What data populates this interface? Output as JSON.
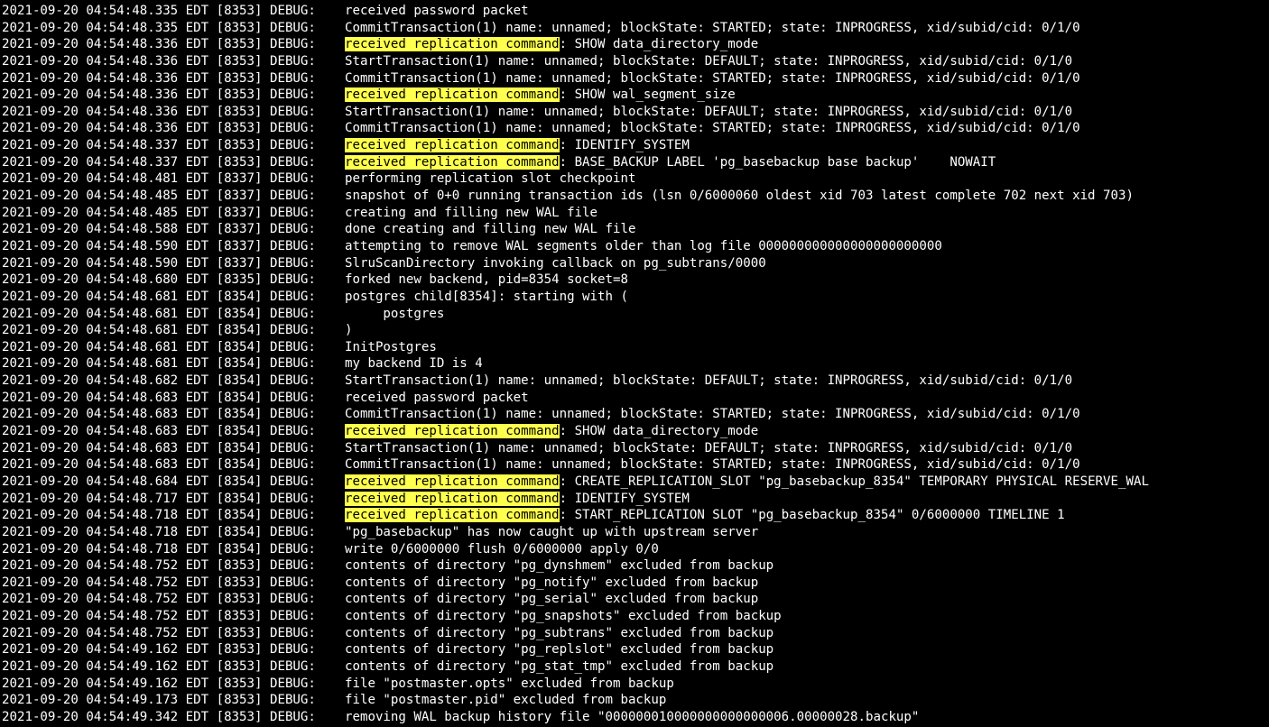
{
  "terminal": {
    "highlight_color": "#ffff4d",
    "lines": [
      {
        "p": "2021-09-20 04:54:48.335 EDT [8353] DEBUG:",
        "h": "",
        "m": "received password packet"
      },
      {
        "p": "2021-09-20 04:54:48.335 EDT [8353] DEBUG:",
        "h": "",
        "m": "CommitTransaction(1) name: unnamed; blockState: STARTED; state: INPROGRESS, xid/subid/cid: 0/1/0"
      },
      {
        "p": "2021-09-20 04:54:48.336 EDT [8353] DEBUG:",
        "h": "received replication command",
        "m": ": SHOW data_directory_mode"
      },
      {
        "p": "2021-09-20 04:54:48.336 EDT [8353] DEBUG:",
        "h": "",
        "m": "StartTransaction(1) name: unnamed; blockState: DEFAULT; state: INPROGRESS, xid/subid/cid: 0/1/0"
      },
      {
        "p": "2021-09-20 04:54:48.336 EDT [8353] DEBUG:",
        "h": "",
        "m": "CommitTransaction(1) name: unnamed; blockState: STARTED; state: INPROGRESS, xid/subid/cid: 0/1/0"
      },
      {
        "p": "2021-09-20 04:54:48.336 EDT [8353] DEBUG:",
        "h": "received replication command",
        "m": ": SHOW wal_segment_size"
      },
      {
        "p": "2021-09-20 04:54:48.336 EDT [8353] DEBUG:",
        "h": "",
        "m": "StartTransaction(1) name: unnamed; blockState: DEFAULT; state: INPROGRESS, xid/subid/cid: 0/1/0"
      },
      {
        "p": "2021-09-20 04:54:48.336 EDT [8353] DEBUG:",
        "h": "",
        "m": "CommitTransaction(1) name: unnamed; blockState: STARTED; state: INPROGRESS, xid/subid/cid: 0/1/0"
      },
      {
        "p": "2021-09-20 04:54:48.337 EDT [8353] DEBUG:",
        "h": "received replication command",
        "m": ": IDENTIFY_SYSTEM"
      },
      {
        "p": "2021-09-20 04:54:48.337 EDT [8353] DEBUG:",
        "h": "received replication command",
        "m": ": BASE_BACKUP LABEL 'pg_basebackup base backup'    NOWAIT"
      },
      {
        "p": "2021-09-20 04:54:48.481 EDT [8337] DEBUG:",
        "h": "",
        "m": "performing replication slot checkpoint"
      },
      {
        "p": "2021-09-20 04:54:48.485 EDT [8337] DEBUG:",
        "h": "",
        "m": "snapshot of 0+0 running transaction ids (lsn 0/6000060 oldest xid 703 latest complete 702 next xid 703)"
      },
      {
        "p": "2021-09-20 04:54:48.485 EDT [8337] DEBUG:",
        "h": "",
        "m": "creating and filling new WAL file"
      },
      {
        "p": "2021-09-20 04:54:48.588 EDT [8337] DEBUG:",
        "h": "",
        "m": "done creating and filling new WAL file"
      },
      {
        "p": "2021-09-20 04:54:48.590 EDT [8337] DEBUG:",
        "h": "",
        "m": "attempting to remove WAL segments older than log file 000000000000000000000000"
      },
      {
        "p": "2021-09-20 04:54:48.590 EDT [8337] DEBUG:",
        "h": "",
        "m": "SlruScanDirectory invoking callback on pg_subtrans/0000"
      },
      {
        "p": "2021-09-20 04:54:48.680 EDT [8335] DEBUG:",
        "h": "",
        "m": "forked new backend, pid=8354 socket=8"
      },
      {
        "p": "2021-09-20 04:54:48.681 EDT [8354] DEBUG:",
        "h": "",
        "m": "postgres child[8354]: starting with ("
      },
      {
        "p": "2021-09-20 04:54:48.681 EDT [8354] DEBUG:",
        "h": "",
        "m": "     postgres"
      },
      {
        "p": "2021-09-20 04:54:48.681 EDT [8354] DEBUG:",
        "h": "",
        "m": ")"
      },
      {
        "p": "2021-09-20 04:54:48.681 EDT [8354] DEBUG:",
        "h": "",
        "m": "InitPostgres"
      },
      {
        "p": "2021-09-20 04:54:48.681 EDT [8354] DEBUG:",
        "h": "",
        "m": "my backend ID is 4"
      },
      {
        "p": "2021-09-20 04:54:48.682 EDT [8354] DEBUG:",
        "h": "",
        "m": "StartTransaction(1) name: unnamed; blockState: DEFAULT; state: INPROGRESS, xid/subid/cid: 0/1/0"
      },
      {
        "p": "2021-09-20 04:54:48.683 EDT [8354] DEBUG:",
        "h": "",
        "m": "received password packet"
      },
      {
        "p": "2021-09-20 04:54:48.683 EDT [8354] DEBUG:",
        "h": "",
        "m": "CommitTransaction(1) name: unnamed; blockState: STARTED; state: INPROGRESS, xid/subid/cid: 0/1/0"
      },
      {
        "p": "2021-09-20 04:54:48.683 EDT [8354] DEBUG:",
        "h": "received replication command",
        "m": ": SHOW data_directory_mode"
      },
      {
        "p": "2021-09-20 04:54:48.683 EDT [8354] DEBUG:",
        "h": "",
        "m": "StartTransaction(1) name: unnamed; blockState: DEFAULT; state: INPROGRESS, xid/subid/cid: 0/1/0"
      },
      {
        "p": "2021-09-20 04:54:48.683 EDT [8354] DEBUG:",
        "h": "",
        "m": "CommitTransaction(1) name: unnamed; blockState: STARTED; state: INPROGRESS, xid/subid/cid: 0/1/0"
      },
      {
        "p": "2021-09-20 04:54:48.684 EDT [8354] DEBUG:",
        "h": "received replication command",
        "m": ": CREATE_REPLICATION_SLOT \"pg_basebackup_8354\" TEMPORARY PHYSICAL RESERVE_WAL"
      },
      {
        "p": "2021-09-20 04:54:48.717 EDT [8354] DEBUG:",
        "h": "received replication command",
        "m": ": IDENTIFY_SYSTEM"
      },
      {
        "p": "2021-09-20 04:54:48.718 EDT [8354] DEBUG:",
        "h": "received replication command",
        "m": ": START_REPLICATION SLOT \"pg_basebackup_8354\" 0/6000000 TIMELINE 1"
      },
      {
        "p": "2021-09-20 04:54:48.718 EDT [8354] DEBUG:",
        "h": "",
        "m": "\"pg_basebackup\" has now caught up with upstream server"
      },
      {
        "p": "2021-09-20 04:54:48.718 EDT [8354] DEBUG:",
        "h": "",
        "m": "write 0/6000000 flush 0/6000000 apply 0/0"
      },
      {
        "p": "2021-09-20 04:54:48.752 EDT [8353] DEBUG:",
        "h": "",
        "m": "contents of directory \"pg_dynshmem\" excluded from backup"
      },
      {
        "p": "2021-09-20 04:54:48.752 EDT [8353] DEBUG:",
        "h": "",
        "m": "contents of directory \"pg_notify\" excluded from backup"
      },
      {
        "p": "2021-09-20 04:54:48.752 EDT [8353] DEBUG:",
        "h": "",
        "m": "contents of directory \"pg_serial\" excluded from backup"
      },
      {
        "p": "2021-09-20 04:54:48.752 EDT [8353] DEBUG:",
        "h": "",
        "m": "contents of directory \"pg_snapshots\" excluded from backup"
      },
      {
        "p": "2021-09-20 04:54:48.752 EDT [8353] DEBUG:",
        "h": "",
        "m": "contents of directory \"pg_subtrans\" excluded from backup"
      },
      {
        "p": "2021-09-20 04:54:49.162 EDT [8353] DEBUG:",
        "h": "",
        "m": "contents of directory \"pg_replslot\" excluded from backup"
      },
      {
        "p": "2021-09-20 04:54:49.162 EDT [8353] DEBUG:",
        "h": "",
        "m": "contents of directory \"pg_stat_tmp\" excluded from backup"
      },
      {
        "p": "2021-09-20 04:54:49.162 EDT [8353] DEBUG:",
        "h": "",
        "m": "file \"postmaster.opts\" excluded from backup"
      },
      {
        "p": "2021-09-20 04:54:49.173 EDT [8353] DEBUG:",
        "h": "",
        "m": "file \"postmaster.pid\" excluded from backup"
      },
      {
        "p": "2021-09-20 04:54:49.342 EDT [8353] DEBUG:",
        "h": "",
        "m": "removing WAL backup history file \"000000010000000000000006.00000028.backup\""
      }
    ]
  }
}
